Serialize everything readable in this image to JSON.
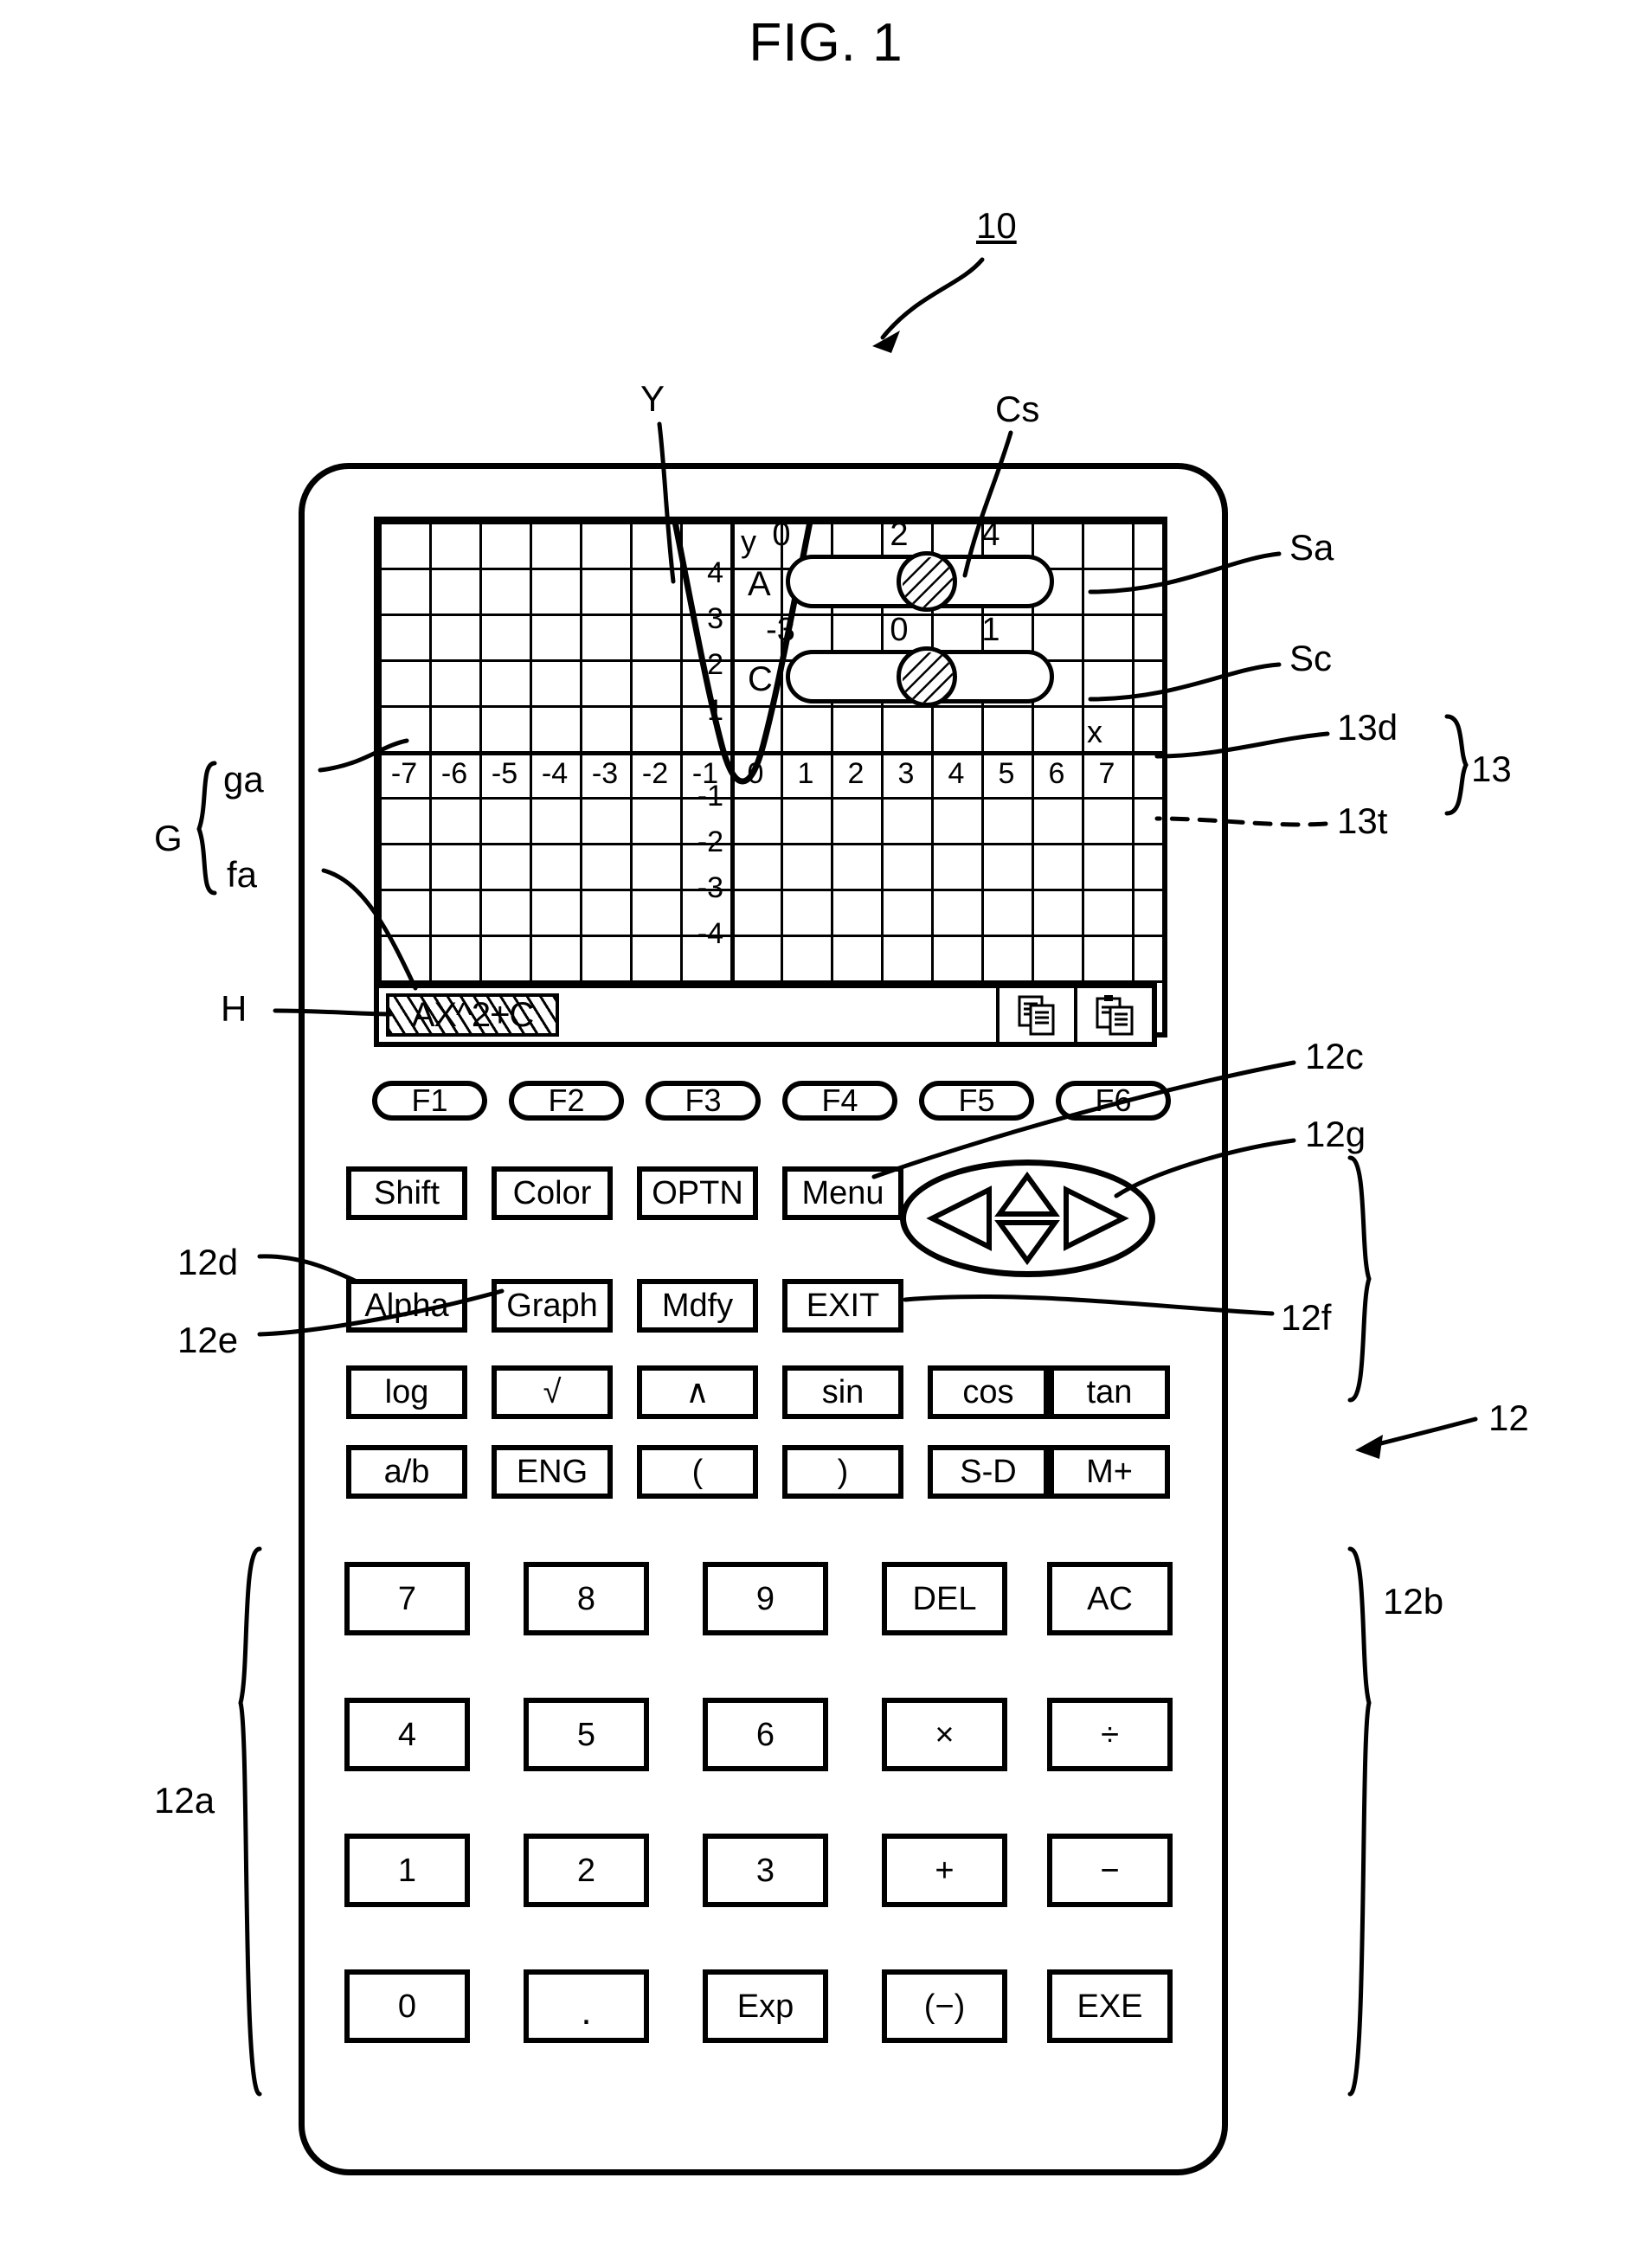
{
  "figure": {
    "title": "FIG. 1",
    "device_ref": "10"
  },
  "callouts": {
    "device": "10",
    "curve": "Y",
    "cursor": "Cs",
    "slider_a": "Sa",
    "slider_c": "Sc",
    "display_area": "13d",
    "touch_panel": "13t",
    "display_unit": "13",
    "graph_group": "G",
    "graph_area": "ga",
    "formula_area": "fa",
    "highlight": "H",
    "menu_key": "12c",
    "cursor_key": "12g",
    "alpha_key": "12d",
    "graph_key": "12e",
    "exit_key": "12f",
    "key_unit": "12",
    "func_keys_group": "12b",
    "num_keys_group": "12a"
  },
  "screen": {
    "formula": {
      "text": "AX^2+C",
      "icons": [
        "copy-icon",
        "paste-icon"
      ]
    },
    "graph": {
      "x_axis_label": "x",
      "y_axis_label": "y"
    },
    "sliders": [
      {
        "name": "A",
        "scale": [
          "0",
          "2",
          "4"
        ],
        "knob_position_pct": 47
      },
      {
        "name": "C",
        "scale": [
          "-3",
          "0",
          "1"
        ],
        "knob_position_pct": 47
      }
    ]
  },
  "chart_data": {
    "type": "line",
    "title": "",
    "xlabel": "x",
    "ylabel": "y",
    "xlim": [
      -7.8,
      7.8
    ],
    "ylim": [
      -4.8,
      4.8
    ],
    "grid": true,
    "x_ticks": [
      "-7",
      "-6",
      "-5",
      "-4",
      "-3",
      "-2",
      "-1",
      "0",
      "1",
      "2",
      "3",
      "4",
      "5",
      "6",
      "7"
    ],
    "y_ticks": [
      "4",
      "3",
      "2",
      "1",
      "-1",
      "-2",
      "-3",
      "-4"
    ],
    "series": [
      {
        "name": "AX^2+C",
        "equation": "y = A*x^2 + C",
        "A": 4,
        "C": -1,
        "x": [
          -1.2,
          -1.0,
          -0.8,
          -0.6,
          -0.4,
          -0.2,
          0.0,
          0.2,
          0.4,
          0.6,
          0.8,
          1.0,
          1.2
        ],
        "values": [
          4.76,
          3.0,
          1.56,
          0.44,
          -0.36,
          -0.84,
          -1.0,
          -0.84,
          -0.36,
          0.44,
          1.56,
          3.0,
          4.76
        ]
      }
    ]
  },
  "keypad": {
    "function_keys": [
      "F1",
      "F2",
      "F3",
      "F4",
      "F5",
      "F6"
    ],
    "row_mode_1": [
      "Shift",
      "Color",
      "OPTN",
      "Menu"
    ],
    "row_mode_2": [
      "Alpha",
      "Graph",
      "Mdfy",
      "EXIT"
    ],
    "row_math_1": [
      "log",
      "√",
      "∧",
      "sin",
      "cos",
      "tan"
    ],
    "row_math_2": [
      "a/b",
      "ENG",
      "(",
      ")",
      "S-D",
      "M+"
    ],
    "row_num_1": [
      "7",
      "8",
      "9",
      "DEL",
      "AC"
    ],
    "row_num_2": [
      "4",
      "5",
      "6",
      "×",
      "÷"
    ],
    "row_num_3": [
      "1",
      "2",
      "3",
      "+",
      "−"
    ],
    "row_num_4": [
      "0",
      ".",
      "Exp",
      "(−)",
      "EXE"
    ],
    "dpad": [
      "up-arrow",
      "left-arrow",
      "right-arrow",
      "down-arrow"
    ]
  }
}
